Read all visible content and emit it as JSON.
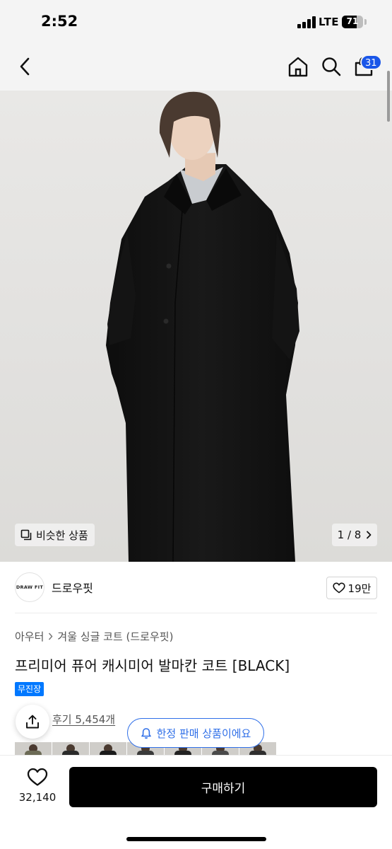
{
  "status_bar": {
    "time": "2:52",
    "network": "LTE",
    "battery_level": "71",
    "battery_fraction": 0.71
  },
  "nav": {
    "back_icon": "chevron-left-icon",
    "home_icon": "home-icon",
    "search_icon": "search-icon",
    "cart_icon": "shopping-bag-icon",
    "cart_count": "31",
    "badge_color": "#1a56e8"
  },
  "hero": {
    "similar_label": "비슷한 상품",
    "page_indicator": "1 / 8"
  },
  "brand": {
    "logo_text": "DRAW FIT",
    "name": "드로우핏",
    "like_count": "19만"
  },
  "product": {
    "breadcrumb": [
      "아우터",
      "겨울 싱글 코트 (드로우핏)"
    ],
    "title": "프리미어 퓨어 캐시미어 발마칸 코트 [BLACK]",
    "badge": "무진장",
    "badge_color": "#0078ff",
    "review_link": "후기 5,454개",
    "limited_notice": "한정 판매 상품이에요",
    "accent_color": "#2f6fe8"
  },
  "bottom_bar": {
    "wish_count": "32,140",
    "buy_label": "구매하기"
  }
}
